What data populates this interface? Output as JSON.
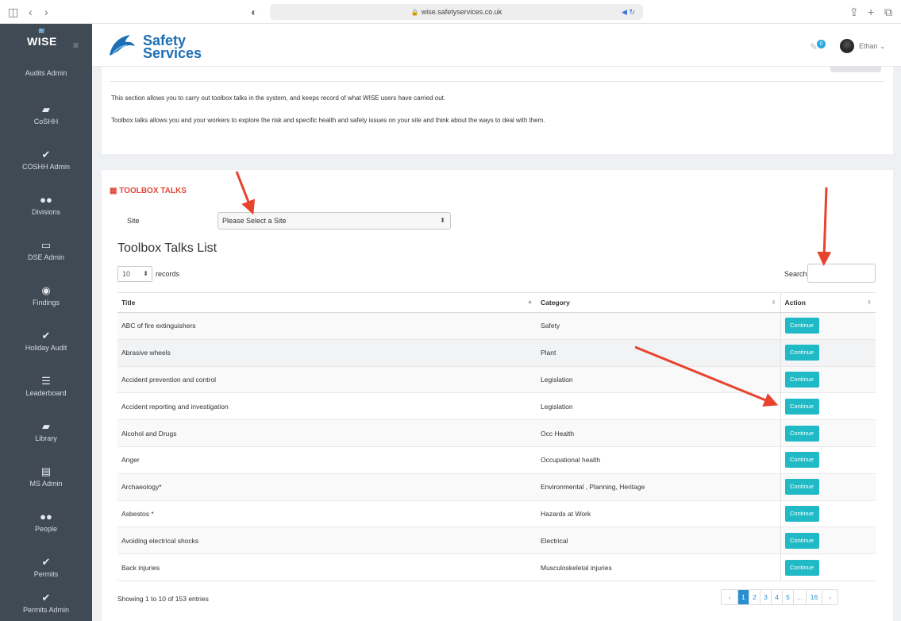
{
  "browser": {
    "url": "wise.safetyservices.co.uk",
    "icons": [
      "sidebar-toggle-icon",
      "back-icon",
      "forward-icon",
      "shield-icon",
      "share-icon",
      "new-tab-icon",
      "tabs-icon"
    ]
  },
  "app": {
    "brand": "WISE",
    "company_line1": "Safety",
    "company_line2": "Services",
    "notification_count": "0",
    "user_name": "Ethan ⌄"
  },
  "sidebar": {
    "cut_item": "Audits Admin",
    "items": [
      {
        "label": "CoSHH",
        "icon": "book-icon"
      },
      {
        "label": "COSHH Admin",
        "icon": "check-icon"
      },
      {
        "label": "Divisions",
        "icon": "users-icon"
      },
      {
        "label": "DSE Admin",
        "icon": "monitor-icon"
      },
      {
        "label": "Findings",
        "icon": "eye-icon"
      },
      {
        "label": "Holiday Audit",
        "icon": "check-icon"
      },
      {
        "label": "Leaderboard",
        "icon": "list-icon"
      },
      {
        "label": "Library",
        "icon": "book-icon"
      },
      {
        "label": "MS Admin",
        "icon": "document-icon"
      },
      {
        "label": "People",
        "icon": "users-icon"
      },
      {
        "label": "Permits",
        "icon": "check-icon"
      },
      {
        "label": "Permits Admin",
        "icon": "check-icon"
      }
    ]
  },
  "intro": {
    "line1": "This section allows you to carry out toolbox talks in the system, and keeps record of what WISE users have carried out.",
    "line2": "Toolbox talks allows you and your workers to explore the risk and specific health and safety issues on your site and think about the ways to deal with them."
  },
  "toolbox": {
    "section_title": "TOOLBOX TALKS",
    "site_label": "Site",
    "site_select": "Please Select a Site",
    "list_title": "Toolbox Talks List",
    "page_length": "10",
    "records_label": "records",
    "search_label": "Search:",
    "search_value": "",
    "columns": [
      "Title",
      "Category",
      "Action"
    ],
    "rows": [
      {
        "title": "ABC of fire extinguishers",
        "category": "Safety",
        "action": "Continue"
      },
      {
        "title": "Abrasive wheels",
        "category": "Plant",
        "action": "Continue"
      },
      {
        "title": "Accident prevention and control",
        "category": "Legislation",
        "action": "Continue"
      },
      {
        "title": "Accident reporting and investigation",
        "category": "Legislation",
        "action": "Continue"
      },
      {
        "title": "Alcohol and Drugs",
        "category": "Occ Health",
        "action": "Continue"
      },
      {
        "title": "Anger",
        "category": "Occupational health",
        "action": "Continue"
      },
      {
        "title": "Archaeology*",
        "category": "Environmental , Planning, Heritage",
        "action": "Continue"
      },
      {
        "title": "Asbestos *",
        "category": "Hazards at Work",
        "action": "Continue"
      },
      {
        "title": "Avoiding electrical shocks",
        "category": "Electrical",
        "action": "Continue"
      },
      {
        "title": "Back injuries",
        "category": "Musculoskeletal injuries",
        "action": "Continue"
      }
    ],
    "info": "Showing 1 to 10 of 153 entries",
    "pagination": {
      "prev": "‹",
      "pages": [
        "1",
        "2",
        "3",
        "4",
        "5"
      ],
      "ellipsis": "...",
      "last": "16",
      "next": "›",
      "current": "1"
    }
  },
  "colors": {
    "sidebar_bg": "#3f4a55",
    "accent_red": "#e0483a",
    "button_teal": "#1fbac6",
    "link_blue": "#2a8fd0",
    "brand_blue": "#1d6fb5",
    "annotation_arrow": "#e8432f"
  }
}
